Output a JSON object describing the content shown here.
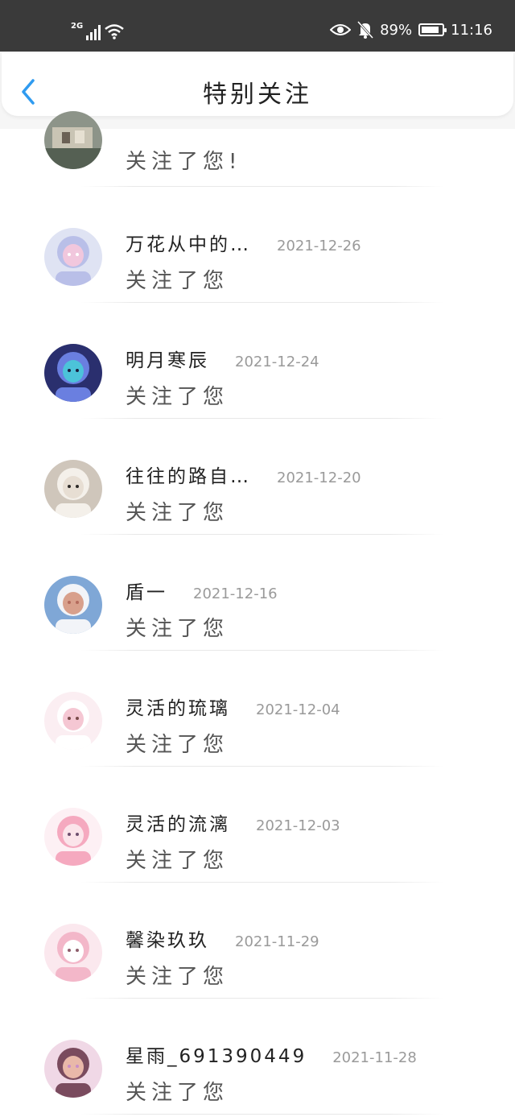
{
  "status_bar": {
    "network": "2G",
    "battery_percent": "89%",
    "battery_level": 0.89,
    "time": "11:16",
    "icons": [
      "signal-icon",
      "wifi-icon",
      "eye-icon",
      "bell-off-icon",
      "battery-icon"
    ]
  },
  "header": {
    "title": "特别关注",
    "back_icon": "chevron-left-icon",
    "accent_color": "#2f9bf0"
  },
  "list": {
    "first_partial": {
      "message": "关注了您!"
    },
    "items": [
      {
        "name": "万花从中的…",
        "date": "2021-12-26",
        "message": "关注了您"
      },
      {
        "name": "明月寒辰",
        "date": "2021-12-24",
        "message": "关注了您"
      },
      {
        "name": "往往的路自…",
        "date": "2021-12-20",
        "message": "关注了您"
      },
      {
        "name": "盾一",
        "date": "2021-12-16",
        "message": "关注了您"
      },
      {
        "name": "灵活的琉璃",
        "date": "2021-12-04",
        "message": "关注了您"
      },
      {
        "name": "灵活的流漓",
        "date": "2021-12-03",
        "message": "关注了您"
      },
      {
        "name": "馨染玖玖",
        "date": "2021-11-29",
        "message": "关注了您"
      },
      {
        "name": "星雨_691390449",
        "date": "2021-11-28",
        "message": "关注了您"
      }
    ]
  }
}
